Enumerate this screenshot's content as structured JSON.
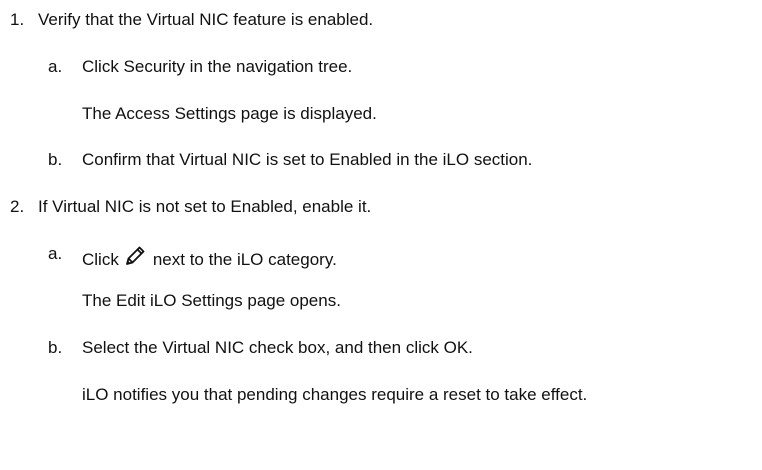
{
  "steps": [
    {
      "number": "1.",
      "text": "Verify that the Virtual NIC feature is enabled.",
      "substeps": [
        {
          "letter": "a.",
          "text": "Click Security in the navigation tree.",
          "result": "The Access Settings page is displayed."
        },
        {
          "letter": "b.",
          "text": "Confirm that Virtual NIC is set to Enabled in the iLO section."
        }
      ]
    },
    {
      "number": "2.",
      "text": "If Virtual NIC is not set to Enabled, enable it.",
      "substeps": [
        {
          "letter": "a.",
          "text_before_icon": "Click",
          "icon": "pencil-edit-icon",
          "text_after_icon": "next to the iLO category.",
          "result": "The Edit iLO Settings page opens."
        },
        {
          "letter": "b.",
          "text": "Select the Virtual NIC check box, and then click OK.",
          "result": "iLO notifies you that pending changes require a reset to take effect."
        }
      ]
    }
  ]
}
